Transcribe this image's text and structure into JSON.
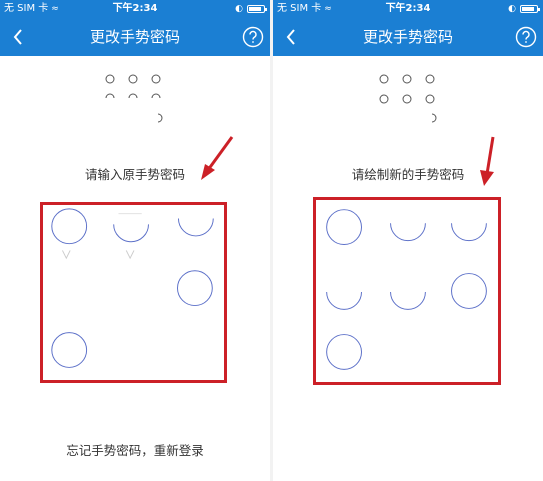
{
  "status_bar": {
    "carrier": "无 SIM 卡",
    "time": "下午2:34",
    "battery_level": 0.85
  },
  "left": {
    "title": "更改手势密码",
    "prompt": "请输入原手势密码",
    "forgot_link": "忘记手势密码，重新登录"
  },
  "right": {
    "title": "更改手势密码",
    "prompt": "请绘制新的手势密码"
  },
  "colors": {
    "header_blue": "#1b7fd3",
    "highlight_red": "#cc2027",
    "circle_stroke": "#5b6fc8"
  },
  "icons": [
    "back-chevron-icon",
    "help-question-icon",
    "wifi-icon",
    "lock-rotation-icon",
    "battery-icon",
    "red-arrow-annotation"
  ]
}
